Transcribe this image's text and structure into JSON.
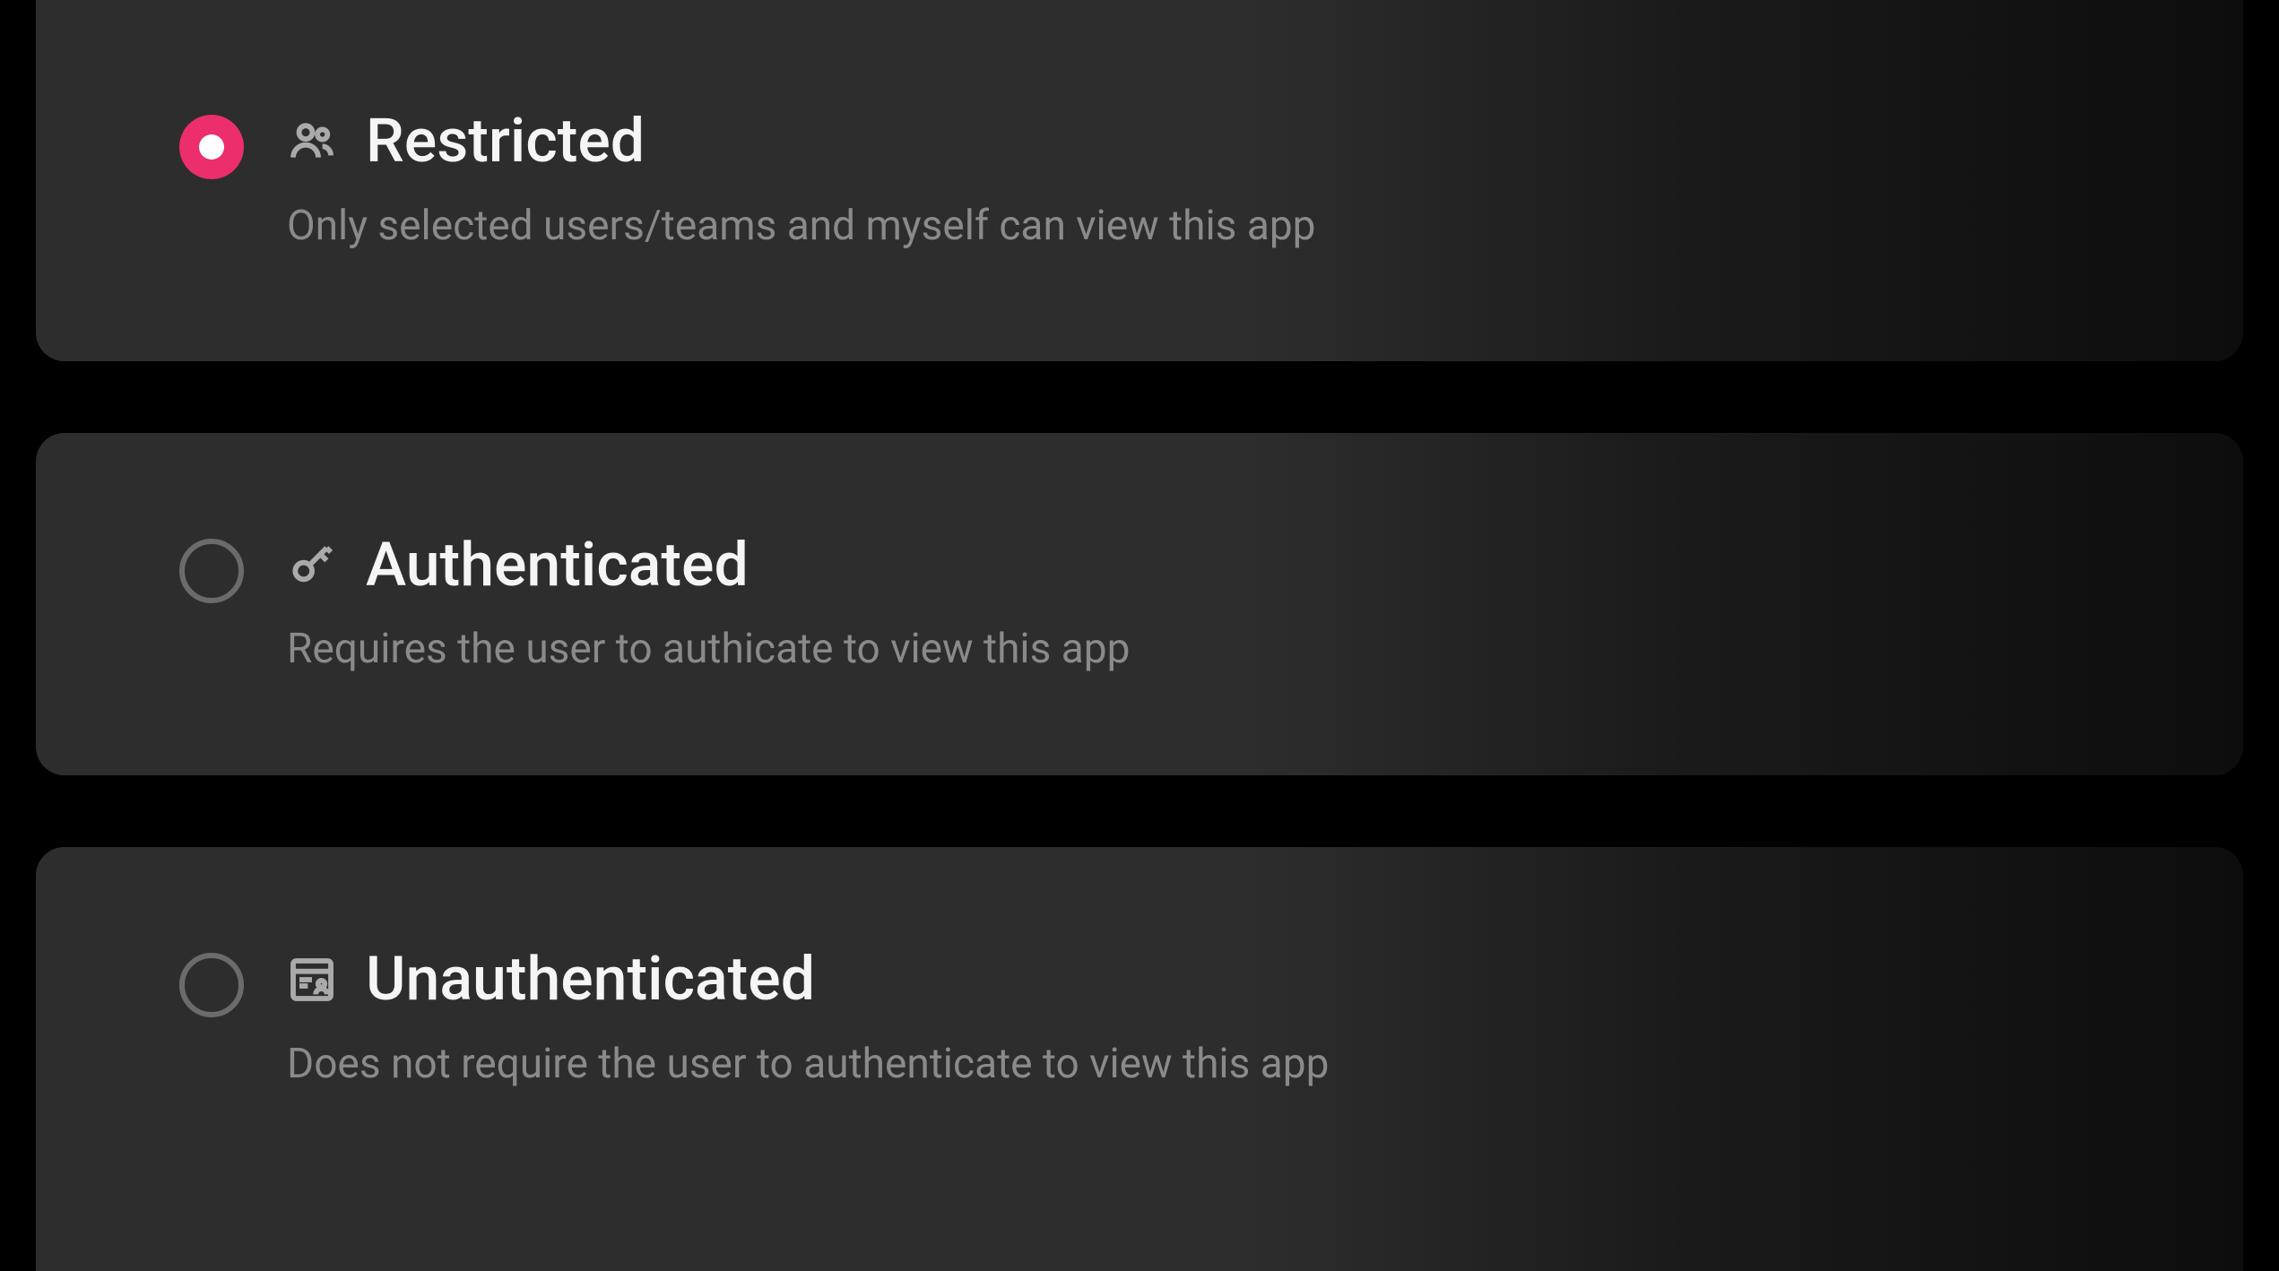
{
  "options": [
    {
      "id": "restricted",
      "title": "Restricted",
      "description": "Only selected users/teams and myself can view this app",
      "icon": "users-icon",
      "selected": true
    },
    {
      "id": "authenticated",
      "title": "Authenticated",
      "description": "Requires the user to authicate to view this app",
      "icon": "key-icon",
      "selected": false
    },
    {
      "id": "unauthenticated",
      "title": "Unauthenticated",
      "description": "Does not require the user to authenticate to view this app",
      "icon": "document-user-icon",
      "selected": false
    }
  ]
}
